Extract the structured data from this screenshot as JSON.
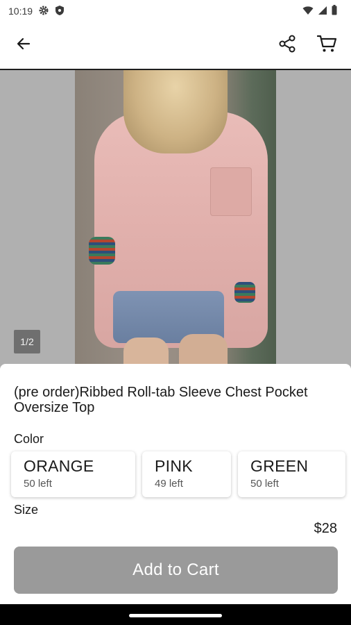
{
  "status_bar": {
    "time": "10:19",
    "icons": [
      "gear-icon",
      "shield-icon",
      "wifi-icon",
      "signal-icon",
      "battery-icon"
    ]
  },
  "app_bar": {
    "icons": [
      "back-arrow-icon",
      "share-icon",
      "cart-icon"
    ]
  },
  "gallery": {
    "page_indicator": "1/2"
  },
  "product": {
    "title": "(pre order)Ribbed Roll-tab Sleeve Chest Pocket Oversize Top",
    "color_label": "Color",
    "colors": [
      {
        "name": "ORANGE",
        "stock": "50 left"
      },
      {
        "name": "PINK",
        "stock": "49 left"
      },
      {
        "name": "GREEN",
        "stock": "50 left"
      }
    ],
    "size_label": "Size",
    "price": "$28"
  },
  "actions": {
    "add_to_cart_label": "Add to Cart"
  },
  "theme": {
    "button_color": "#9a9a9a",
    "divider_color": "#1e1e1e"
  }
}
